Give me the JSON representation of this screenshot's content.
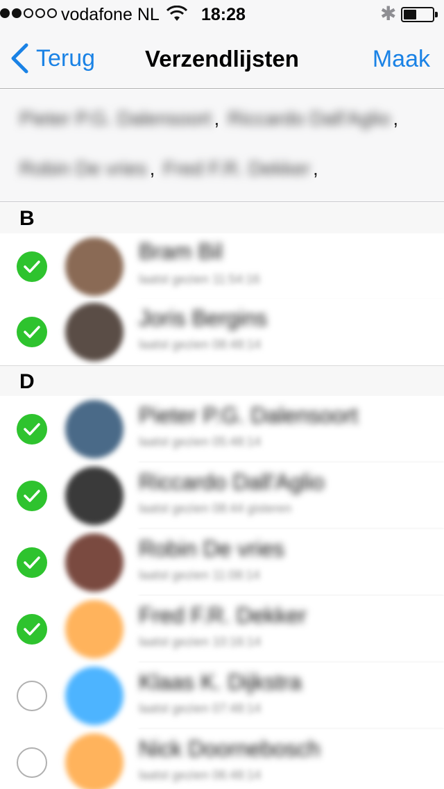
{
  "status": {
    "signal_filled": 2,
    "signal_total": 5,
    "carrier": "vodafone NL",
    "time": "18:28",
    "battery_level": 0.45
  },
  "nav": {
    "back_label": "Terug",
    "title": "Verzendlijsten",
    "action_label": "Maak",
    "accent_color": "#1a82e5"
  },
  "recipients": [
    "Pieter P.G. Dalensoort",
    "Riccardo Dall'Aglio",
    "Robin De vries",
    "Fred F.R. Dekker"
  ],
  "sections": [
    {
      "letter": "B",
      "contacts": [
        {
          "name": "Bram Bil",
          "subtitle": "laatst gezien 11:54:16",
          "checked": true
        },
        {
          "name": "Joris Bergins",
          "subtitle": "laatst gezien 08:48:14",
          "checked": true
        }
      ]
    },
    {
      "letter": "D",
      "contacts": [
        {
          "name": "Pieter P.G. Dalensoort",
          "subtitle": "laatst gezien 05:48:14",
          "checked": true
        },
        {
          "name": "Riccardo Dall'Aglio",
          "subtitle": "laatst gezien 08:44 gisteren",
          "checked": true
        },
        {
          "name": "Robin De vries",
          "subtitle": "laatst gezien 11:08:14",
          "checked": true
        },
        {
          "name": "Fred F.R. Dekker",
          "subtitle": "laatst gezien 10:16:14",
          "checked": true
        },
        {
          "name": "Klaas K. Dijkstra",
          "subtitle": "laatst gezien 07:48:14",
          "checked": false
        },
        {
          "name": "Nick Doornebosch",
          "subtitle": "laatst gezien 06:48:14",
          "checked": false
        }
      ]
    }
  ],
  "colors": {
    "check_on": "#2ec32e",
    "avatar_palette": [
      "#8a6a55",
      "#5a4d46",
      "#4a6a88",
      "#3a3a3a",
      "#7a4a40",
      "#ffb35c",
      "#4db4ff",
      "#ffb35c"
    ]
  }
}
